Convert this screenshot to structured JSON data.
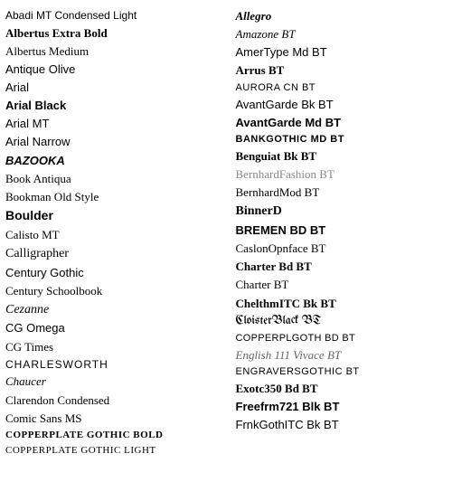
{
  "left_column": [
    {
      "label": "Abadi MT Condensed Light",
      "class": "f-abadi"
    },
    {
      "label": "Albertus Extra Bold",
      "class": "f-albertus-bold"
    },
    {
      "label": "Albertus Medium",
      "class": "f-albertus-medium"
    },
    {
      "label": "Antique Olive",
      "class": "f-antique-olive"
    },
    {
      "label": "Arial",
      "class": "f-arial"
    },
    {
      "label": "Arial Black",
      "class": "f-arial-black"
    },
    {
      "label": "Arial MT",
      "class": "f-arial-mt"
    },
    {
      "label": "Arial Narrow",
      "class": "f-arial-narrow"
    },
    {
      "label": "BAZOOKA",
      "class": "f-bazooka"
    },
    {
      "label": "Book Antiqua",
      "class": "f-book-antiqua"
    },
    {
      "label": "Bookman Old Style",
      "class": "f-bookman"
    },
    {
      "label": "Boulder",
      "class": "f-boulder"
    },
    {
      "label": "Calisto MT",
      "class": "f-calisto"
    },
    {
      "label": "Calligrapher",
      "class": "f-calligrapher"
    },
    {
      "label": "Century Gothic",
      "class": "f-century-gothic"
    },
    {
      "label": "Century Schoolbook",
      "class": "f-century-schoolbook"
    },
    {
      "label": "Cezanne",
      "class": "f-cezanne"
    },
    {
      "label": "CG Omega",
      "class": "f-cg-omega"
    },
    {
      "label": "CG Times",
      "class": "f-cg-times"
    },
    {
      "label": "CHARLESWORTH",
      "class": "f-charlesworth"
    },
    {
      "label": "Chaucer",
      "class": "f-chaucer"
    },
    {
      "label": "Clarendon Condensed",
      "class": "f-clarendon"
    },
    {
      "label": "Comic Sans MS",
      "class": "f-comic-sans"
    },
    {
      "label": "Copperplate Gothic Bold",
      "class": "f-copperplate-bold"
    },
    {
      "label": "Copperplate Gothic Light",
      "class": "f-copperplate-light"
    }
  ],
  "right_column": [
    {
      "label": "Allegro",
      "class": "f-allegro"
    },
    {
      "label": "Amazone BT",
      "class": "f-amazone"
    },
    {
      "label": "AmerType Md BT",
      "class": "f-amertype"
    },
    {
      "label": "Arrus BT",
      "class": "f-arrus"
    },
    {
      "label": "Aurora Cn BT",
      "class": "f-aurora"
    },
    {
      "label": "AvantGarde Bk BT",
      "class": "f-avantgarde-bk"
    },
    {
      "label": "AvantGarde Md BT",
      "class": "f-avantgarde-md"
    },
    {
      "label": "BankGothic Md BT",
      "class": "f-bankgothic"
    },
    {
      "label": "Benguiat Bk BT",
      "class": "f-benguiat"
    },
    {
      "label": "BernhardFashion BT",
      "class": "f-bernhard-fashion"
    },
    {
      "label": "BernhardMod BT",
      "class": "f-bernhardmod"
    },
    {
      "label": "BinnerD",
      "class": "f-binnerd"
    },
    {
      "label": "BREMEN BD BT",
      "class": "f-bremen"
    },
    {
      "label": "CaslonOpnface BT",
      "class": "f-caslon"
    },
    {
      "label": "Charter Bd BT",
      "class": "f-charter-bd"
    },
    {
      "label": "Charter BT",
      "class": "f-charter"
    },
    {
      "label": "ChelthmITC Bk BT",
      "class": "f-chelthm"
    },
    {
      "label": "CloisterBlack BT",
      "class": "f-cloister"
    },
    {
      "label": "CopperplGoth Bd BT",
      "class": "f-copperpplate-goth"
    },
    {
      "label": "English 111 Vivace BT",
      "class": "f-english111"
    },
    {
      "label": "EngraversGothic BT",
      "class": "f-engravers"
    },
    {
      "label": "Exotc350 Bd BT",
      "class": "f-exotc350"
    },
    {
      "label": "Freefrm721 Blk BT",
      "class": "f-freefrm"
    },
    {
      "label": "FrnkGothITC Bk BT",
      "class": "f-frnkgoth"
    }
  ]
}
